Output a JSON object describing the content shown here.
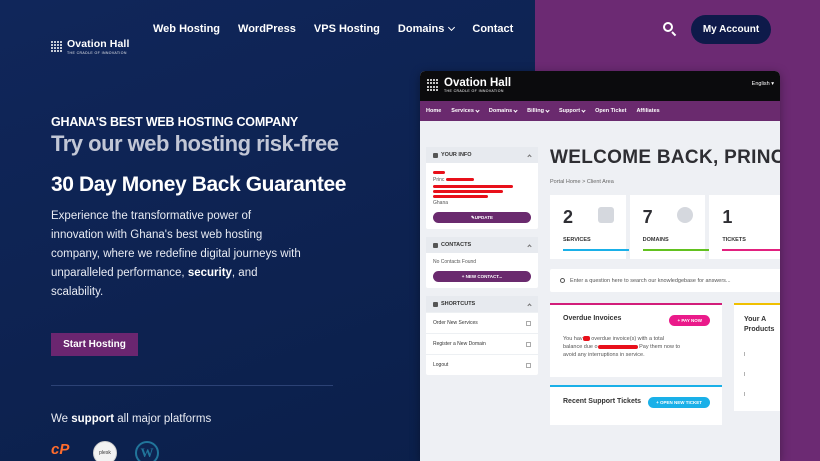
{
  "brand": {
    "name": "Ovation Hall",
    "tagline": "THE CRADLE OF INNOVATION"
  },
  "nav": {
    "items": [
      {
        "label": "Web Hosting"
      },
      {
        "label": "WordPress"
      },
      {
        "label": "VPS Hosting"
      },
      {
        "label": "Domains"
      },
      {
        "label": "Contact"
      }
    ],
    "account_label": "My Account"
  },
  "hero": {
    "eyebrow": "GHANA'S BEST WEB HOSTING COMPANY",
    "title": "Try our web hosting risk-free",
    "guarantee": "30 Day Money Back Guarantee",
    "desc_1": "Experience the transformative power of innovation with Ghana's best web hosting company, where we redefine digital journeys with unparalleled performance, ",
    "desc_bold": "security",
    "desc_2": ", and scalability.",
    "cta": "Start Hosting",
    "platforms_1": "We ",
    "platforms_bold": "support",
    "platforms_2": " all major platforms",
    "platform_logos": {
      "cpanel": "cP",
      "plesk": "plesk",
      "wordpress": "W"
    }
  },
  "client_area": {
    "language": "English",
    "nav": [
      "Home",
      "Services",
      "Domains",
      "Billing",
      "Support",
      "Open Ticket",
      "Affiliates"
    ],
    "your_info": {
      "title": "YOUR INFO",
      "prefix": "Princ",
      "location": "Ghana",
      "update_label": "UPDATE"
    },
    "contacts": {
      "title": "CONTACTS",
      "empty": "No Contacts Found",
      "new_label": "+ NEW CONTACT..."
    },
    "shortcuts": {
      "title": "SHORTCUTS",
      "items": [
        "Order New Services",
        "Register a New Domain",
        "Logout"
      ]
    },
    "welcome": "WELCOME BACK, PRINC",
    "breadcrumb": {
      "home": "Portal Home",
      "current": "Client Area"
    },
    "stats": [
      {
        "value": "2",
        "label": "SERVICES",
        "color": "#1ab0e8"
      },
      {
        "value": "7",
        "label": "DOMAINS",
        "color": "#62c11f"
      },
      {
        "value": "1",
        "label": "TICKETS",
        "color": "#e2217f"
      }
    ],
    "kb_placeholder": "Enter a question here to search our knowledgebase for answers...",
    "overdue": {
      "title": "Overdue Invoices",
      "button": "+ PAY NOW",
      "text_1": "You hav",
      "text_2": "overdue invoice(s) with a total",
      "text_3": "balance due o",
      "text_4": "Pay them now to",
      "text_5": "avoid any interruptions in service."
    },
    "tickets": {
      "title": "Recent Support Tickets",
      "button": "+ OPEN NEW TICKET"
    },
    "products": {
      "title_1": "Your A",
      "title_2": "Products"
    }
  }
}
